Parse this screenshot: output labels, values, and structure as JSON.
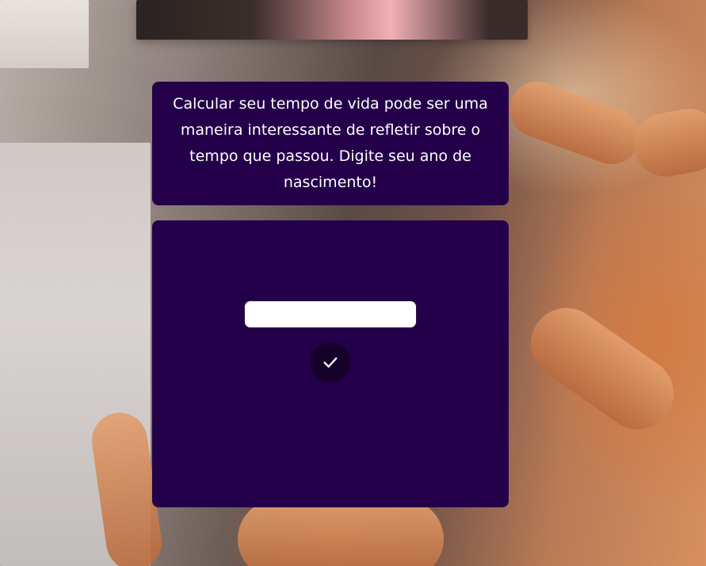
{
  "info": {
    "text": "Calcular seu tempo de vida pode ser uma maneira interessante de refletir sobre o tempo que passou. Digite seu ano de nascimento!"
  },
  "form": {
    "year_input_value": "",
    "year_input_placeholder": "",
    "submit_icon": "check-icon"
  },
  "colors": {
    "panel": "#24004a",
    "button": "#140028",
    "text": "#ffffff"
  }
}
